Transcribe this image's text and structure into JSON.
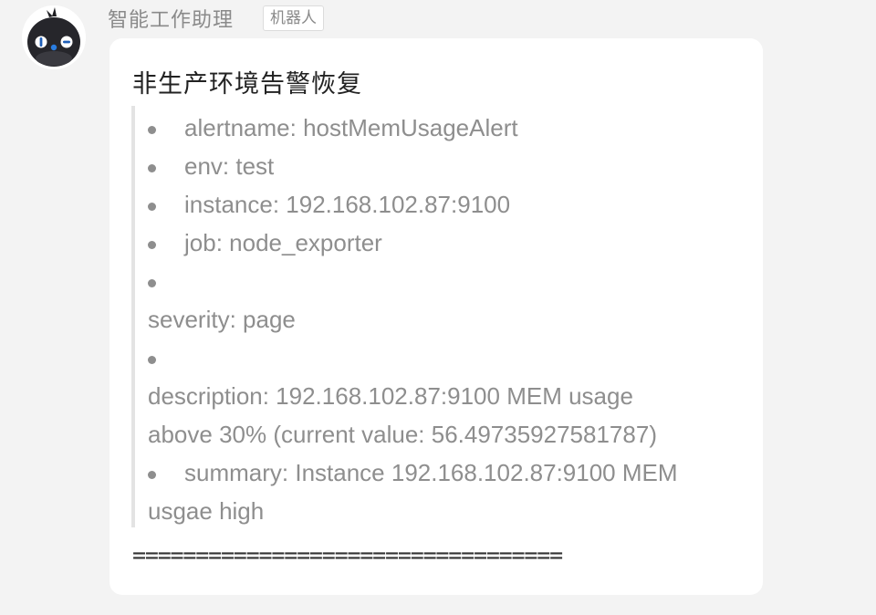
{
  "sender": {
    "name": "智能工作助理",
    "badge": "机器人"
  },
  "message": {
    "title": "非生产环境告警恢复",
    "items": [
      "alertname: hostMemUsageAlert",
      "env: test",
      "instance: 192.168.102.87:9100",
      "job: node_exporter"
    ],
    "severity": "severity: page",
    "description_line1": "description: 192.168.102.87:9100 MEM usage",
    "description_line2": "above 30% (current value: 56.49735927581787)",
    "summary_line1": "summary: Instance 192.168.102.87:9100 MEM",
    "summary_line2": "usgae high",
    "separator": "=================================="
  },
  "colors": {
    "background": "#f3f3f3",
    "card": "#ffffff",
    "muted_text": "#8e8e8e",
    "title_text": "#222222"
  },
  "icons": {
    "avatar": "bot-avatar-icon"
  }
}
